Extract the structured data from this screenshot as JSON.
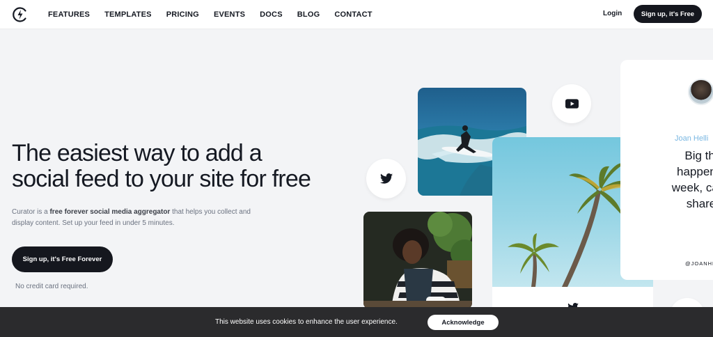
{
  "header": {
    "nav": [
      "FEATURES",
      "TEMPLATES",
      "PRICING",
      "EVENTS",
      "DOCS",
      "BLOG",
      "CONTACT"
    ],
    "login_label": "Login",
    "signup_label": "Sign up, it's Free"
  },
  "hero": {
    "title_line1": "The easiest way to add a",
    "title_line2": "social feed to your site for free",
    "desc_prefix": "Curator is a ",
    "desc_bold": "free forever social media aggregator",
    "desc_suffix": " that helps you collect and display content. Set up your feed in under 5 minutes.",
    "cta_label": "Sign up, it's Free Forever",
    "note": "No credit card required."
  },
  "feed": {
    "icons": [
      "twitter-icon",
      "youtube-icon",
      "twitter-icon"
    ],
    "quote_card": {
      "name": "Joan Helli",
      "text_line1": "Big thi",
      "text_line2": "happenin",
      "text_line3": "week, can't",
      "text_line4": "share",
      "handle": "@JOANHE"
    }
  },
  "cookie": {
    "text": "This website uses cookies to enhance the user experience.",
    "button_label": "Acknowledge"
  },
  "colors": {
    "background": "#f3f4f6",
    "dark": "#15171e",
    "accent_blue": "#79b7e2",
    "cookie_bar": "#2b2b2d"
  }
}
